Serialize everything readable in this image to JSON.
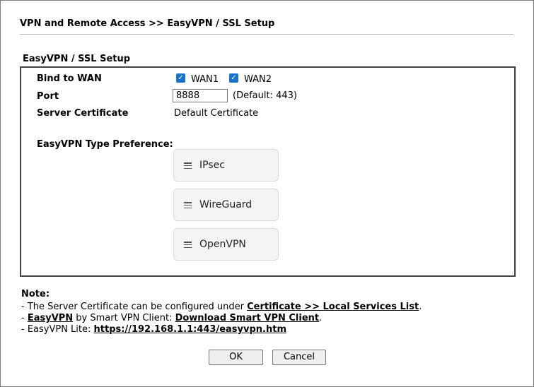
{
  "page": {
    "title": "VPN and Remote Access >> EasyVPN / SSL Setup"
  },
  "section": {
    "title": "EasyVPN / SSL Setup",
    "bind_to_wan": {
      "label": "Bind to WAN",
      "options": [
        {
          "label": "WAN1",
          "checked": true
        },
        {
          "label": "WAN2",
          "checked": true
        }
      ]
    },
    "port": {
      "label": "Port",
      "value": "8888",
      "default_text": "(Default: 443)"
    },
    "server_certificate": {
      "label": "Server Certificate",
      "value": "Default Certificate"
    },
    "type_preference": {
      "label": "EasyVPN Type Preference:",
      "items": [
        "IPsec",
        "WireGuard",
        "OpenVPN"
      ]
    }
  },
  "note": {
    "title": "Note:",
    "line1": {
      "prefix": "- The Server Certificate can be configured under ",
      "link": "Certificate >> Local Services List",
      "suffix": "."
    },
    "line2": {
      "prefix": "- ",
      "link1": "EasyVPN",
      "middle": " by Smart VPN Client: ",
      "link2": "Download Smart VPN Client",
      "suffix": "."
    },
    "line3": {
      "prefix": "- EasyVPN Lite: ",
      "link": "https://192.168.1.1:443/easyvpn.htm"
    }
  },
  "buttons": {
    "ok": "OK",
    "cancel": "Cancel"
  },
  "colors": {
    "checkbox": "#1a73c8",
    "pref_item_bg": "#f4f4f4"
  },
  "icons": {
    "check": "checkmark-icon",
    "drag": "drag-handle-icon"
  }
}
